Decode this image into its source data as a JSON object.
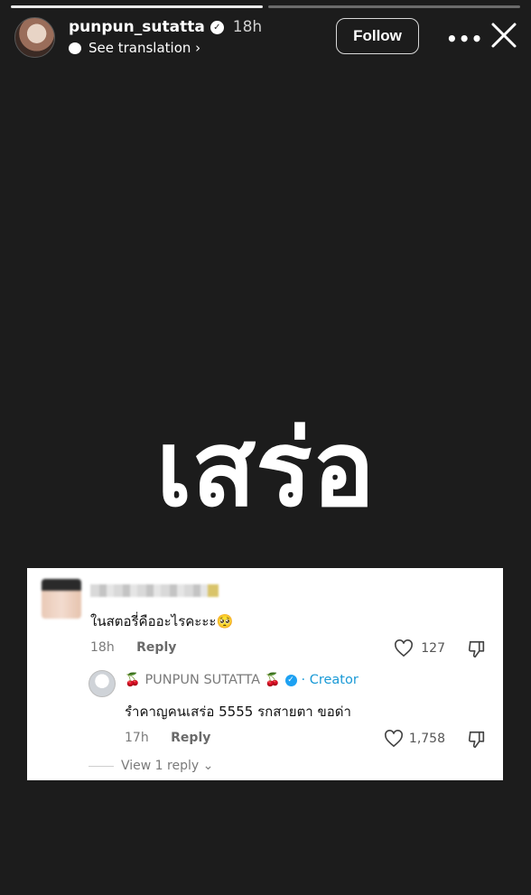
{
  "story": {
    "progress_segments": 2,
    "active_segment": 1,
    "username": "punpun_sutatta",
    "time": "18h",
    "see_translation": "See translation ›",
    "follow_label": "Follow",
    "more_label": "•••",
    "main_text": "เสร่อ"
  },
  "comment": {
    "text": "ในสตอรี่คืออะไรคะะะ🥺",
    "time": "18h",
    "reply_label": "Reply",
    "likes": "127"
  },
  "reply": {
    "cherry_left": "🍒",
    "name": "PUNPUN SUTATTA",
    "cherry_right": "🍒",
    "creator_label": "· Creator",
    "text": "รำคาญคนเสร่อ 5555 รกสายตา ขอด่า",
    "time": "17h",
    "reply_label": "Reply",
    "likes": "1,758"
  },
  "view_replies": "View 1 reply ⌄",
  "colors": {
    "background": "#1c1c1c",
    "card": "#ffffff",
    "creator_blue": "#1a9ad6"
  }
}
